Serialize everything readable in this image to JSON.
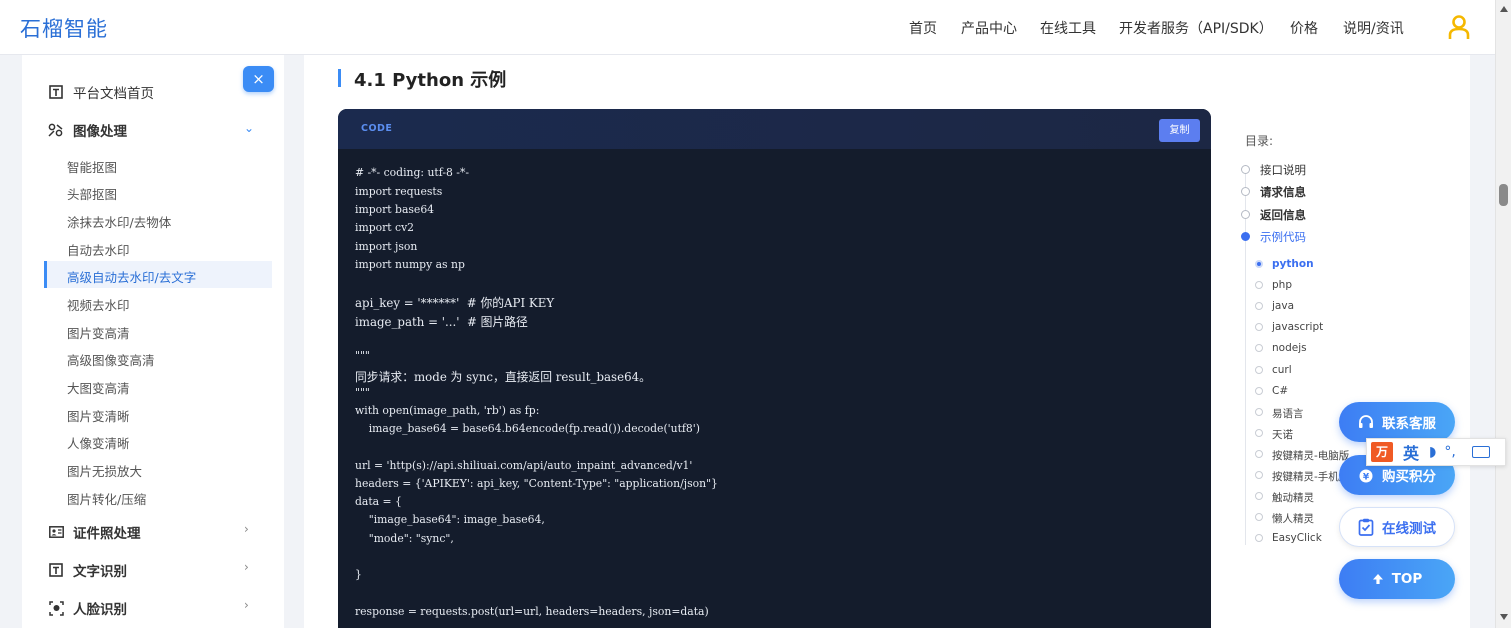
{
  "brand": "石榴智能",
  "nav": [
    "首页",
    "产品中心",
    "在线工具",
    "开发者服务（API/SDK）",
    "价格",
    "说明/资讯"
  ],
  "sidebar": {
    "close_label": "×",
    "home": "平台文档首页",
    "image_processing": "图像处理",
    "sub_items": [
      "智能抠图",
      "头部抠图",
      "涂抹去水印/去物体",
      "自动去水印",
      "高级自动去水印/去文字",
      "视频去水印",
      "图片变高清",
      "高级图像变高清",
      "大图变高清",
      "图片变清晰",
      "人像变清晰",
      "图片无损放大",
      "图片转化/压缩"
    ],
    "active_sub": "高级自动去水印/去文字",
    "id_photo": "证件照处理",
    "ocr": "文字识别",
    "face": "人脸识别"
  },
  "main": {
    "section_title": "4.1 Python 示例",
    "code_tag": "CODE",
    "copy_label": "复制",
    "code_lines": [
      "# -*- coding: utf-8 -*-",
      "import requests",
      "import base64",
      "import cv2",
      "import json",
      "import numpy as np",
      "",
      "api_key = '******'  # 你的API KEY",
      "image_path = '...'  # 图片路径",
      "",
      "\"\"\"",
      "同步请求：mode 为 sync，直接返回 result_base64。",
      "\"\"\"",
      "with open(image_path, 'rb') as fp:",
      "    image_base64 = base64.b64encode(fp.read()).decode('utf8')",
      "",
      "url = 'http(s)://api.shiliuai.com/api/auto_inpaint_advanced/v1'",
      "headers = {'APIKEY': api_key, \"Content-Type\": \"application/json\"}",
      "data = {",
      "    \"image_base64\": image_base64,",
      "    \"mode\": \"sync\",",
      "",
      "}",
      "",
      "response = requests.post(url=url, headers=headers, json=data)"
    ]
  },
  "toc": {
    "title": "目录:",
    "items": [
      "接口说明",
      "请求信息",
      "返回信息",
      "示例代码"
    ],
    "active_item": "示例代码",
    "sub_items": [
      "python",
      "php",
      "java",
      "javascript",
      "nodejs",
      "curl",
      "C#",
      "易语言",
      "天诺",
      "按键精灵-电脑版",
      "按键精灵-手机版",
      "触动精灵",
      "懒人精灵",
      "EasyClick"
    ],
    "active_sub": "python"
  },
  "float": {
    "contact": "联系客服",
    "buy": "购买积分",
    "test": "在线测试",
    "top": "TOP"
  },
  "ime": {
    "logo": "万",
    "mode": "英"
  },
  "colors": {
    "accent": "#3b8cf5",
    "brand": "#2a6fd6",
    "code_bg": "#141c2c",
    "user_icon": "#f5b800"
  }
}
